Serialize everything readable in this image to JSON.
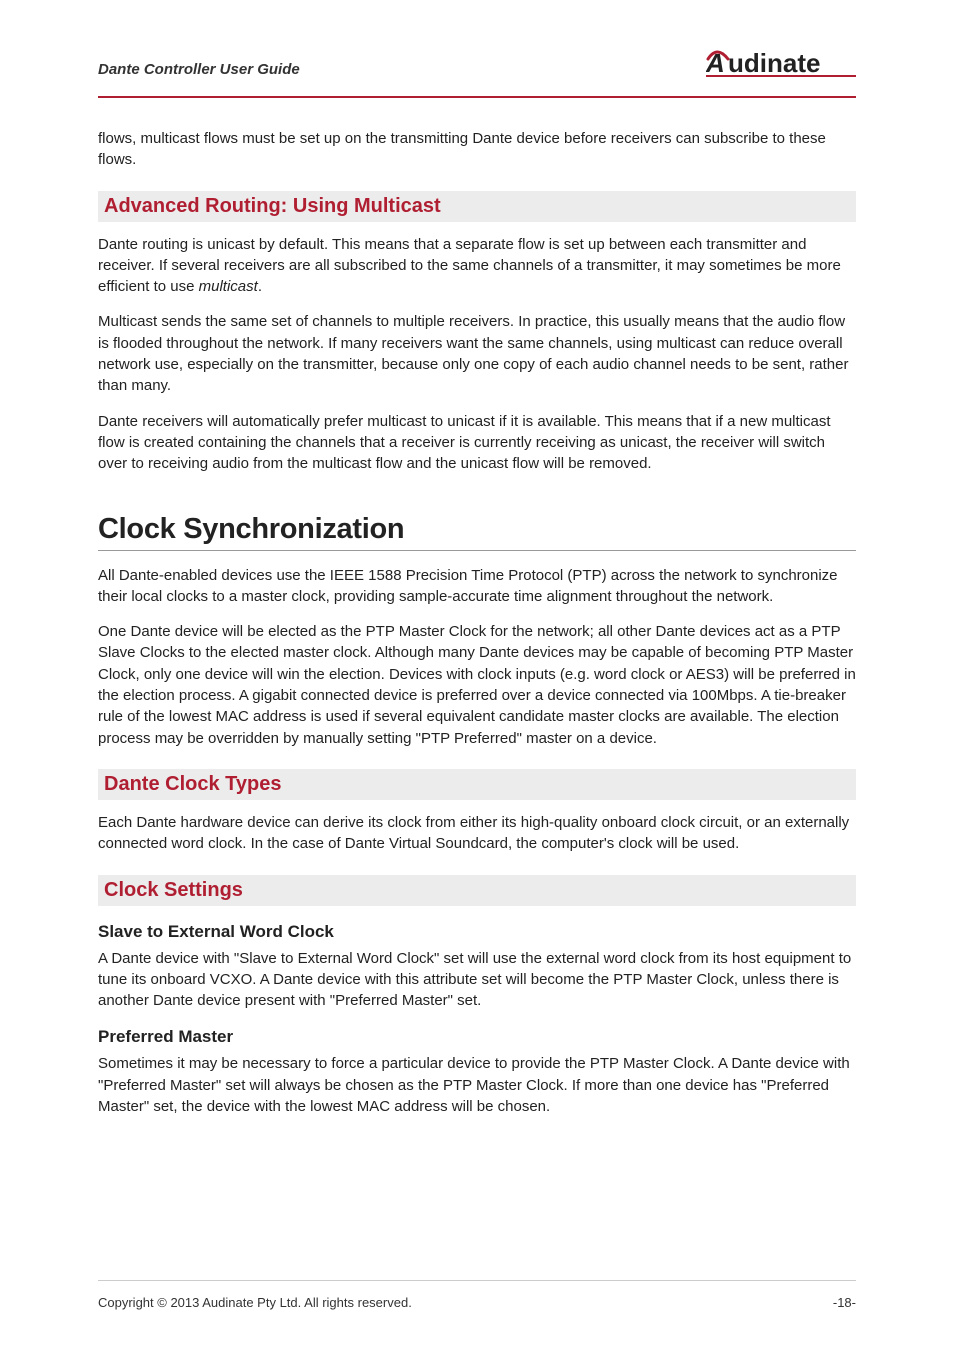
{
  "header": {
    "title": "Dante Controller User Guide",
    "logo_text": "udinate"
  },
  "intro_para": "flows, multicast flows must be set up on the transmitting Dante device before receivers can subscribe to these flows.",
  "advanced_routing": {
    "heading": "Advanced Routing: Using Multicast",
    "p1_a": "Dante routing is unicast by default. This means that a separate flow is set up between each transmitter and receiver. If several receivers are all subscribed to the same channels of a transmitter, it may sometimes be more efficient to use ",
    "p1_i": "multicast",
    "p1_b": ".",
    "p2": "Multicast sends the same set of channels to multiple receivers. In practice, this usually means that the audio flow is flooded throughout the network. If many receivers want the same channels, using multicast can reduce overall network use, especially on the transmitter, because only one copy of each audio channel needs to be sent, rather than many.",
    "p3": "Dante receivers will automatically prefer multicast to unicast if it is available. This means that if a new multicast flow is created containing the channels that a receiver is currently receiving as unicast, the receiver will switch over to receiving audio from the multicast flow and the unicast flow will be removed."
  },
  "clock_sync": {
    "heading": "Clock Synchronization",
    "p1": "All Dante-enabled devices use the IEEE 1588 Precision Time Protocol (PTP) across the network to synchronize their local clocks to a master clock, providing sample-accurate time alignment throughout the network.",
    "p2": "One Dante device will be elected as the PTP Master Clock for the network; all other Dante devices act as a PTP Slave Clocks to the elected master clock. Although many Dante devices may be capable of becoming PTP Master Clock, only one device will win the election. Devices with clock inputs (e.g. word clock or AES3) will be preferred in the election process. A gigabit connected device is preferred over a device connected via 100Mbps. A tie-breaker rule of the lowest MAC address is used if several equivalent candidate master clocks are available. The election process may be overridden by manually setting \"PTP Preferred\" master on a device."
  },
  "clock_types": {
    "heading": "Dante Clock Types",
    "p1": "Each Dante hardware device can derive its clock from either its high-quality onboard clock circuit, or an externally connected word clock. In the case of Dante Virtual Soundcard, the computer's clock will be used."
  },
  "clock_settings": {
    "heading": "Clock Settings",
    "sub1_heading": "Slave to External Word Clock",
    "sub1_p": "A Dante device with \"Slave to External Word Clock\" set will use the external word clock from its host equipment to tune its onboard VCXO. A Dante device with this attribute set will become the PTP Master Clock, unless there is another Dante device present with \"Preferred Master\" set.",
    "sub2_heading": "Preferred Master",
    "sub2_p": "Sometimes it may be necessary to force a particular device to provide the PTP Master Clock. A Dante device with \"Preferred Master\" set will always be chosen as the PTP Master Clock. If more than one device has \"Preferred Master\" set, the device with the lowest MAC address will be chosen."
  },
  "footer": {
    "copyright": "Copyright © 2013 Audinate Pty Ltd. All rights reserved.",
    "page": "-18-"
  }
}
